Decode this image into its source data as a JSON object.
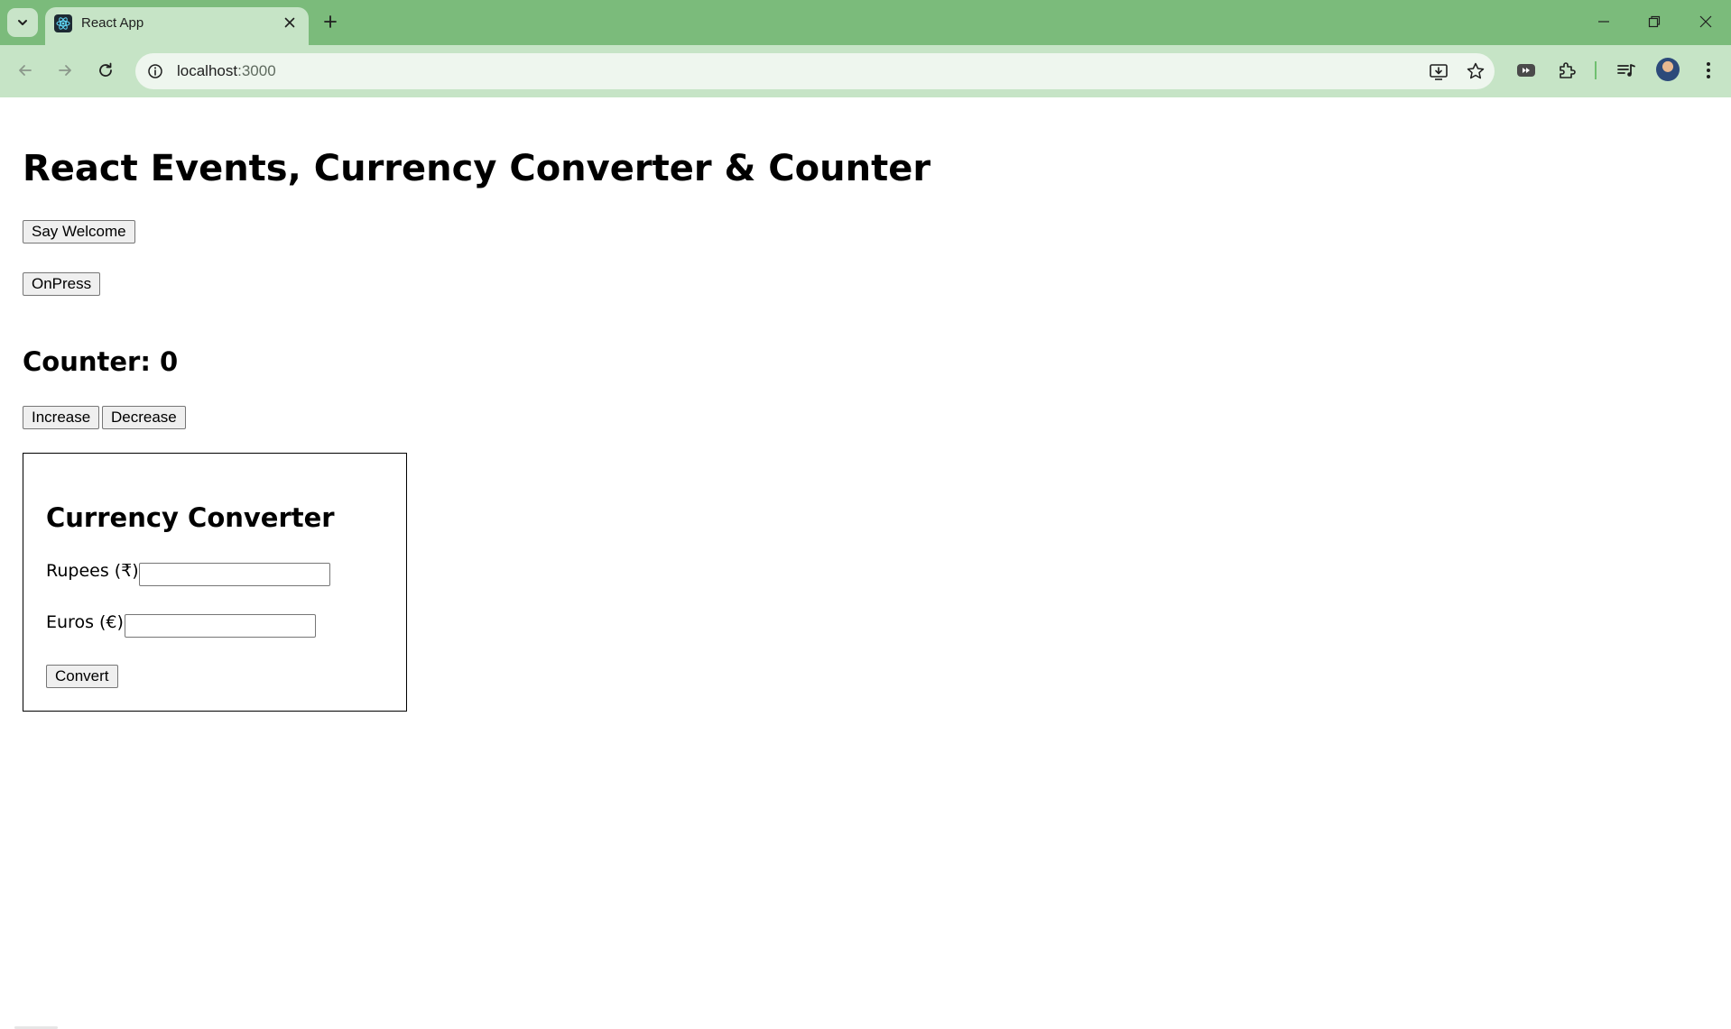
{
  "browser": {
    "tab_title": "React App",
    "url_host": "localhost",
    "url_port": ":3000"
  },
  "page": {
    "heading": "React Events, Currency Converter & Counter",
    "say_welcome_label": "Say Welcome",
    "onpress_label": "OnPress",
    "counter": {
      "label": "Counter: 0",
      "increase_label": "Increase",
      "decrease_label": "Decrease"
    },
    "converter": {
      "title": "Currency Converter",
      "rupees_label": "Rupees (₹):",
      "rupees_value": "",
      "euros_label": "Euros (€):",
      "euros_value": "",
      "convert_label": "Convert"
    }
  },
  "colors": {
    "chrome_frame": "#7bbb7b",
    "chrome_toolbar": "#c6e4c6",
    "omnibox": "#eef6ee"
  }
}
